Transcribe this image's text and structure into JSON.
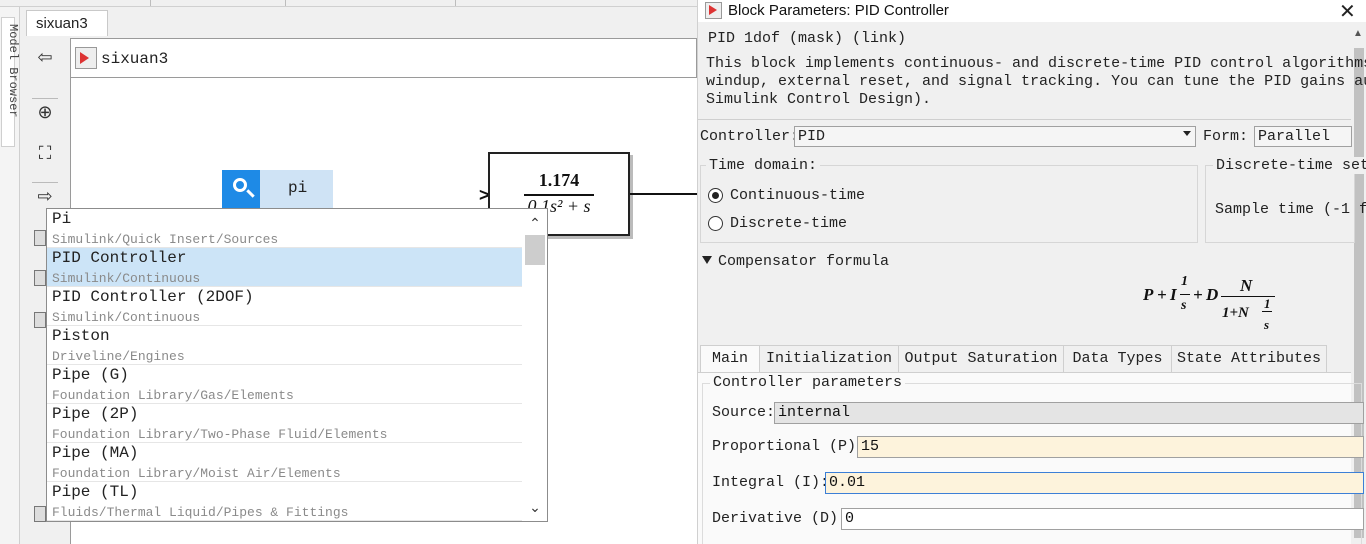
{
  "simulink": {
    "model_tab": "sixuan3",
    "browser_label": "Model Browser",
    "address": "sixuan3",
    "transfer_function": {
      "numerator": "1.174",
      "denominator": "0.1s² + s"
    },
    "quick_insert": {
      "query": "pi",
      "items": [
        {
          "name": "Pi",
          "path": "Simulink/Quick Insert/Sources",
          "selected": false
        },
        {
          "name": "PID Controller",
          "path": "Simulink/Continuous",
          "selected": true
        },
        {
          "name": "PID Controller (2DOF)",
          "path": "Simulink/Continuous",
          "selected": false
        },
        {
          "name": "Piston",
          "path": "Driveline/Engines",
          "selected": false
        },
        {
          "name": "Pipe (G)",
          "path": "Foundation Library/Gas/Elements",
          "selected": false
        },
        {
          "name": "Pipe (2P)",
          "path": "Foundation Library/Two-Phase Fluid/Elements",
          "selected": false
        },
        {
          "name": "Pipe (MA)",
          "path": "Foundation Library/Moist Air/Elements",
          "selected": false
        },
        {
          "name": "Pipe (TL)",
          "path": "Fluids/Thermal Liquid/Pipes & Fittings",
          "selected": false
        }
      ]
    }
  },
  "dialog": {
    "title": "Block Parameters: PID Controller",
    "mask_type": "PID 1dof (mask) (link)",
    "description_lines": [
      "This block implements continuous- and discrete-time PID control algorithms and i",
      "windup, external reset, and signal tracking. You can tune the PID gains automati",
      "Simulink Control Design)."
    ],
    "controller_label": "Controller:",
    "controller_value": "PID",
    "form_label": "Form:",
    "form_value": "Parallel",
    "time_domain": {
      "legend": "Time domain:",
      "options": [
        {
          "label": "Continuous-time",
          "selected": true
        },
        {
          "label": "Discrete-time",
          "selected": false
        }
      ]
    },
    "discrete_settings": {
      "legend": "Discrete-time set",
      "sample_time_label": "Sample time (-1 f"
    },
    "compensator": {
      "label": "Compensator formula",
      "formula": {
        "p": "P",
        "plus1": "+",
        "i": "I",
        "one1": "1",
        "s1": "s",
        "plus2": "+",
        "d": "D",
        "n": "N",
        "den": "1+N",
        "one2": "1",
        "s2": "s"
      }
    },
    "tabs": [
      "Main",
      "Initialization",
      "Output Saturation",
      "Data Types",
      "State Attributes"
    ],
    "active_tab": "Main",
    "controller_parameters": {
      "legend": "Controller parameters",
      "source_label": "Source:",
      "source_value": "internal",
      "proportional_label": "Proportional (P):",
      "proportional_value": "15",
      "integral_label": "Integral (I):",
      "integral_value": "0.01",
      "derivative_label": "Derivative (D):",
      "derivative_value": "0"
    }
  }
}
